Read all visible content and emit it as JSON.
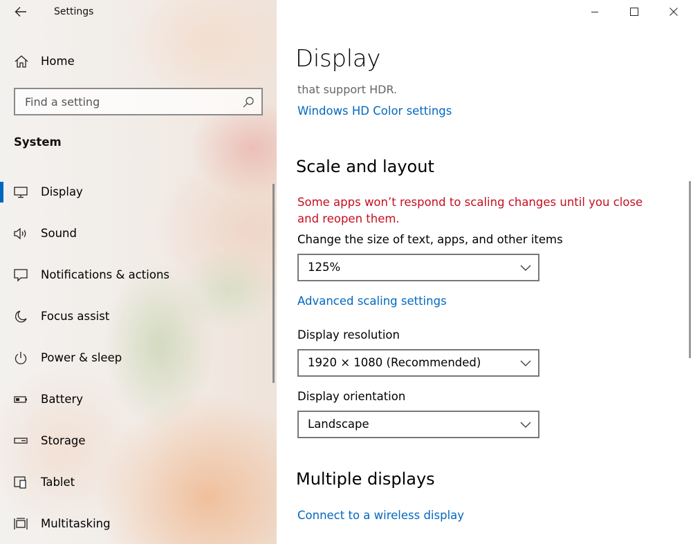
{
  "window": {
    "app_title": "Settings",
    "controls": {
      "minimize": "minimize-icon",
      "maximize": "maximize-icon",
      "close": "close-icon"
    }
  },
  "sidebar": {
    "home_label": "Home",
    "search": {
      "placeholder": "Find a setting",
      "value": ""
    },
    "section_label": "System",
    "items": [
      {
        "label": "Display",
        "icon": "monitor-icon",
        "active": true
      },
      {
        "label": "Sound",
        "icon": "speaker-icon",
        "active": false
      },
      {
        "label": "Notifications & actions",
        "icon": "notification-icon",
        "active": false
      },
      {
        "label": "Focus assist",
        "icon": "moon-icon",
        "active": false
      },
      {
        "label": "Power & sleep",
        "icon": "power-icon",
        "active": false
      },
      {
        "label": "Battery",
        "icon": "battery-icon",
        "active": false
      },
      {
        "label": "Storage",
        "icon": "storage-icon",
        "active": false
      },
      {
        "label": "Tablet",
        "icon": "tablet-icon",
        "active": false
      },
      {
        "label": "Multitasking",
        "icon": "multitasking-icon",
        "active": false
      }
    ]
  },
  "main": {
    "title": "Display",
    "hdr_tail": "that support HDR.",
    "hd_color_link": "Windows HD Color settings",
    "scale_section": {
      "title": "Scale and layout",
      "warning": "Some apps won’t respond to scaling changes until you close and reopen them.",
      "size_label": "Change the size of text, apps, and other items",
      "size_value": "125%",
      "advanced_link": "Advanced scaling settings",
      "resolution_label": "Display resolution",
      "resolution_value": "1920 × 1080 (Recommended)",
      "orientation_label": "Display orientation",
      "orientation_value": "Landscape"
    },
    "multiple_section": {
      "title": "Multiple displays",
      "wireless_link": "Connect to a wireless display"
    }
  },
  "colors": {
    "accent": "#0067c0",
    "warning": "#c50f1f"
  }
}
